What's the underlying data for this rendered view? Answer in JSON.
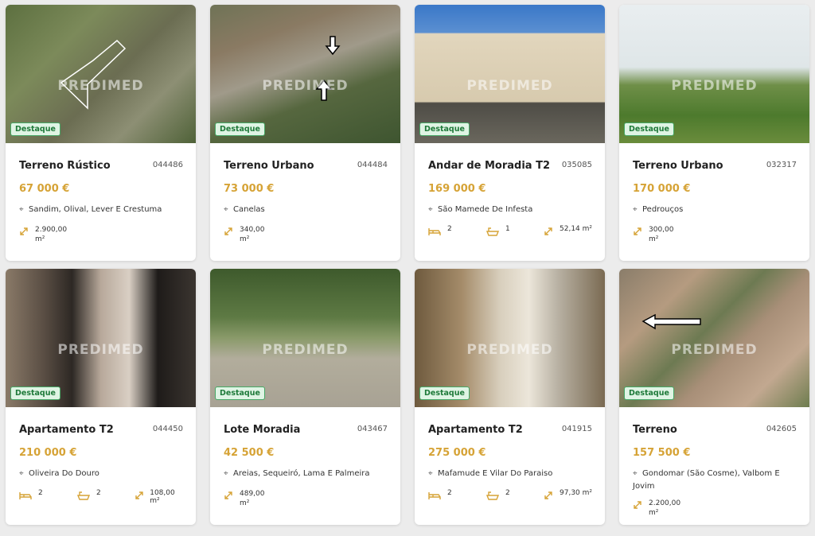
{
  "watermark": "PREDIMED",
  "listings": [
    {
      "badge": "Destaque",
      "title": "Terreno Rústico",
      "ref": "044486",
      "price": "67 000 €",
      "location": "Sandim, Olival, Lever E Crestuma",
      "area": "2.900,00",
      "area_unit": "m²"
    },
    {
      "badge": "Destaque",
      "title": "Terreno Urbano",
      "ref": "044484",
      "price": "73 000 €",
      "location": "Canelas",
      "area": "340,00",
      "area_unit": "m²"
    },
    {
      "badge": "Destaque",
      "title": "Andar de Moradia T2",
      "ref": "035085",
      "price": "169 000 €",
      "location": "São Mamede De Infesta",
      "beds": "2",
      "baths": "1",
      "area_full": "52,14 m²"
    },
    {
      "badge": "Destaque",
      "title": "Terreno Urbano",
      "ref": "032317",
      "price": "170 000 €",
      "location": "Pedrouços",
      "area": "300,00",
      "area_unit": "m²"
    },
    {
      "badge": "Destaque",
      "title": "Apartamento T2",
      "ref": "044450",
      "price": "210 000 €",
      "location": "Oliveira Do Douro",
      "beds": "2",
      "baths": "2",
      "area_full": "108,00 m²"
    },
    {
      "badge": "Destaque",
      "title": "Lote Moradia",
      "ref": "043467",
      "price": "42 500 €",
      "location": "Areias, Sequeiró, Lama E Palmeira",
      "area": "489,00",
      "area_unit": "m²"
    },
    {
      "badge": "Destaque",
      "title": "Apartamento T2",
      "ref": "041915",
      "price": "275 000 €",
      "location": "Mafamude E Vilar Do Paraiso",
      "beds": "2",
      "baths": "2",
      "area_full": "97,30 m²"
    },
    {
      "badge": "Destaque",
      "title": "Terreno",
      "ref": "042605",
      "price": "157 500 €",
      "location": "Gondomar (São Cosme), Valbom E Jovim",
      "area": "2.200,00",
      "area_unit": "m²"
    }
  ]
}
